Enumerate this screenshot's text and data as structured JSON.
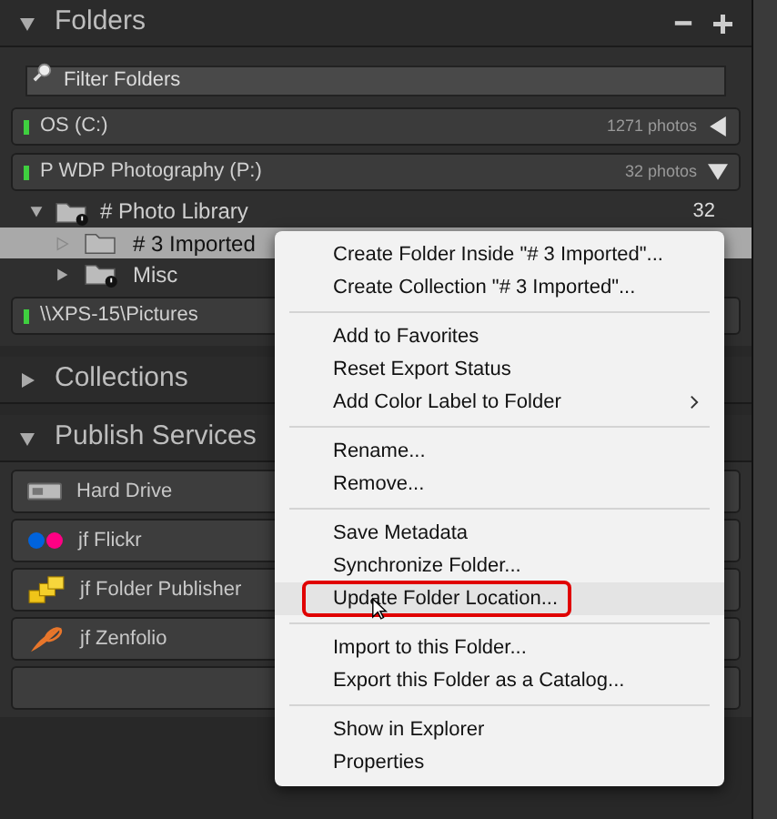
{
  "folders_panel": {
    "title": "Folders",
    "expanded": true,
    "filter": {
      "placeholder": "Filter Folders"
    },
    "volumes_top": [
      {
        "name": "OS (C:)",
        "count": "1271 photos",
        "expanded": false
      },
      {
        "name": "P WDP Photography (P:)",
        "count": "32 photos",
        "expanded": true
      }
    ],
    "tree": [
      {
        "name": "# Photo Library",
        "count": "32",
        "expanded": true,
        "children": [
          {
            "name": "# 3 Imported",
            "selected": true,
            "has_children": false
          },
          {
            "name": "Misc",
            "selected": false,
            "has_children": true
          }
        ]
      }
    ],
    "volumes_bottom": [
      {
        "name": "\\\\XPS-15\\Pictures"
      }
    ]
  },
  "collections_panel": {
    "title": "Collections",
    "expanded": false
  },
  "publish_panel": {
    "title": "Publish Services",
    "expanded": true,
    "services": [
      {
        "name": "Hard Drive",
        "kind": "drive"
      },
      {
        "name": "jf Flickr",
        "kind": "flickr"
      },
      {
        "name": "jf Folder Publisher",
        "kind": "folders"
      },
      {
        "name": "jf Zenfolio",
        "kind": "zenfolio"
      }
    ]
  },
  "context_menu": {
    "groups": [
      [
        {
          "label": "Create Folder Inside \"# 3 Imported\"...",
          "submenu": false,
          "highlighted": false
        },
        {
          "label": "Create Collection \"# 3 Imported\"...",
          "submenu": false,
          "highlighted": false
        }
      ],
      [
        {
          "label": "Add to Favorites",
          "submenu": false,
          "highlighted": false
        },
        {
          "label": "Reset Export Status",
          "submenu": false,
          "highlighted": false
        },
        {
          "label": "Add Color Label to Folder",
          "submenu": true,
          "highlighted": false
        }
      ],
      [
        {
          "label": "Rename...",
          "submenu": false,
          "highlighted": false
        },
        {
          "label": "Remove...",
          "submenu": false,
          "highlighted": false
        }
      ],
      [
        {
          "label": "Save Metadata",
          "submenu": false,
          "highlighted": false
        },
        {
          "label": "Synchronize Folder...",
          "submenu": false,
          "highlighted": false
        },
        {
          "label": "Update Folder Location...",
          "submenu": false,
          "highlighted": true
        }
      ],
      [
        {
          "label": "Import to this Folder...",
          "submenu": false,
          "highlighted": false
        },
        {
          "label": "Export this Folder as a Catalog...",
          "submenu": false,
          "highlighted": false
        }
      ],
      [
        {
          "label": "Show in Explorer",
          "submenu": false,
          "highlighted": false
        },
        {
          "label": "Properties",
          "submenu": false,
          "highlighted": false
        }
      ]
    ]
  }
}
